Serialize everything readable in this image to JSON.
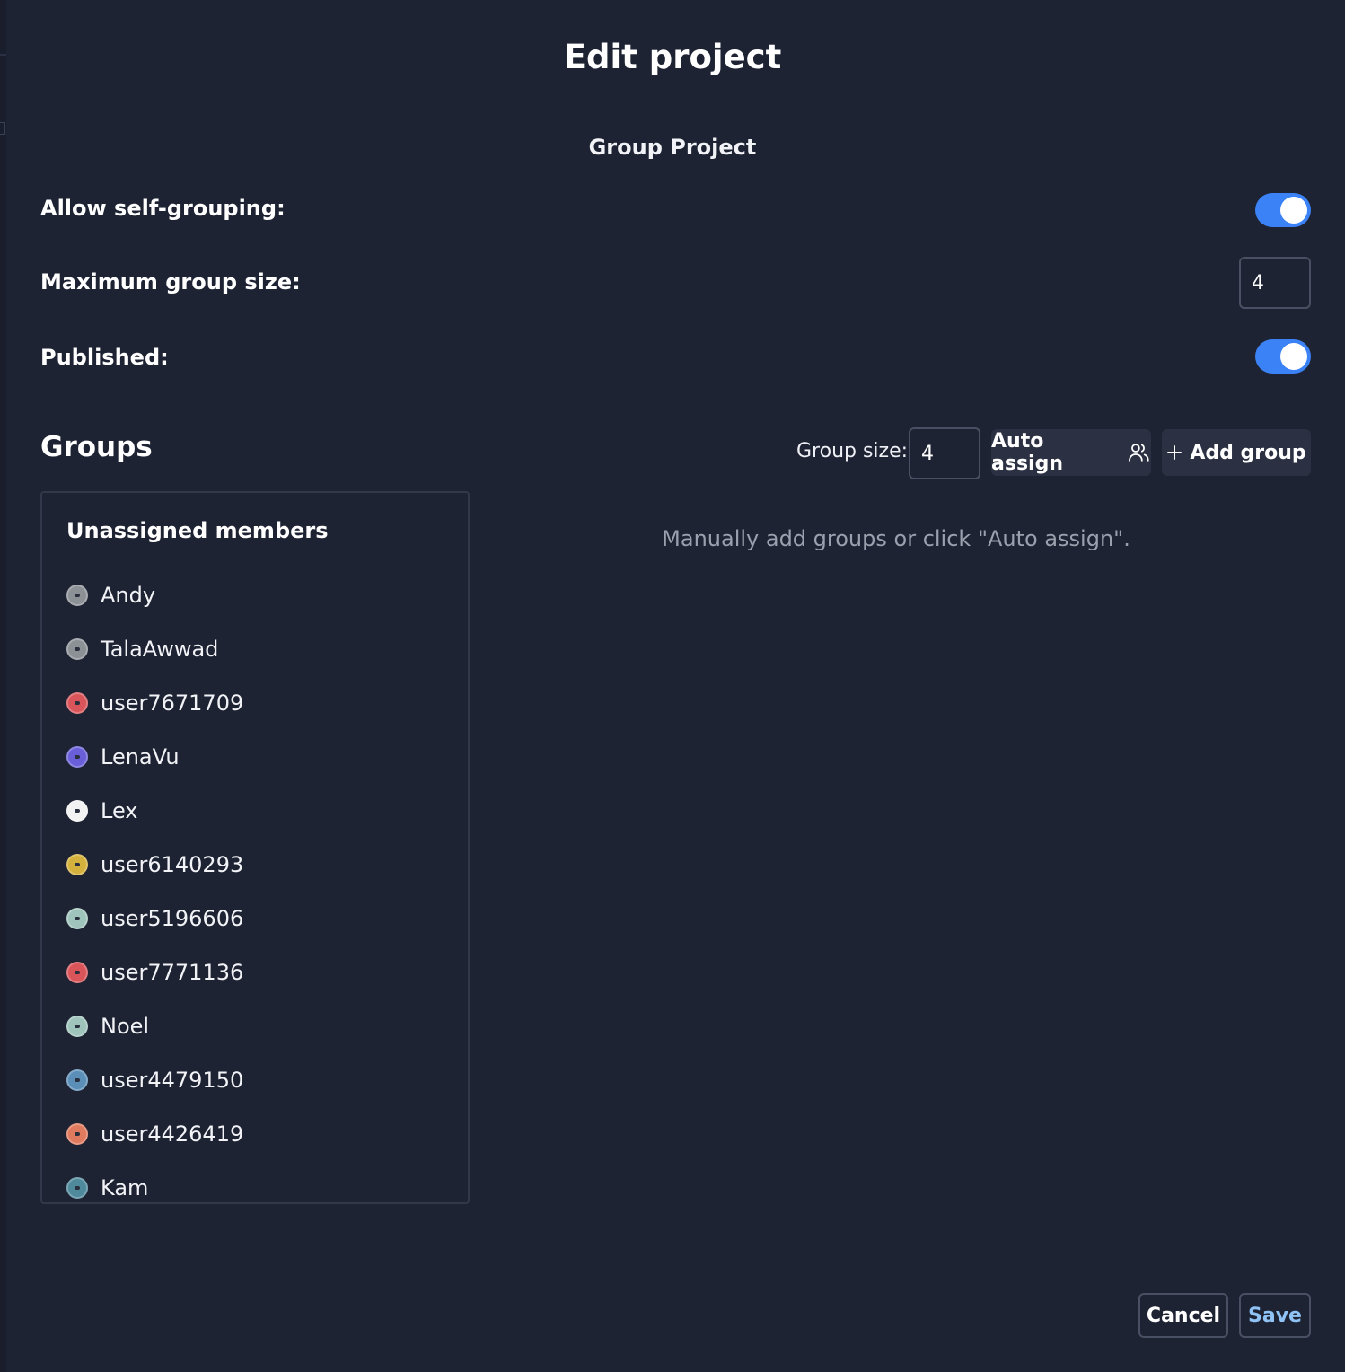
{
  "dialog": {
    "title": "Edit project",
    "project_name": "Group Project"
  },
  "settings": {
    "allow_self_grouping": {
      "label": "Allow self-grouping:",
      "enabled": true
    },
    "max_group_size": {
      "label": "Maximum group size:",
      "value": "4"
    },
    "published": {
      "label": "Published:",
      "enabled": true
    }
  },
  "groups": {
    "heading": "Groups",
    "group_size_label": "Group size:",
    "group_size_value": "4",
    "auto_assign_label": "Auto assign",
    "add_group_label": "Add group",
    "empty_hint": "Manually add groups or click \"Auto assign\".",
    "unassigned": {
      "heading": "Unassigned members",
      "members": [
        {
          "name": "Andy",
          "avatar_color": "#8c9196"
        },
        {
          "name": "TalaAwwad",
          "avatar_color": "#8c9196"
        },
        {
          "name": "user7671709",
          "avatar_color": "#d9555a"
        },
        {
          "name": "LenaVu",
          "avatar_color": "#6a5fd8"
        },
        {
          "name": "Lex",
          "avatar_color": "#f2f2f2"
        },
        {
          "name": "user6140293",
          "avatar_color": "#d4b13c"
        },
        {
          "name": "user5196606",
          "avatar_color": "#9fc4bb"
        },
        {
          "name": "user7771136",
          "avatar_color": "#d9555a"
        },
        {
          "name": "Noel",
          "avatar_color": "#9fc4bb"
        },
        {
          "name": "user4479150",
          "avatar_color": "#5b8fb8"
        },
        {
          "name": "user4426419",
          "avatar_color": "#e07a5f"
        },
        {
          "name": "Kam",
          "avatar_color": "#4f8a9c"
        }
      ]
    }
  },
  "footer": {
    "cancel_label": "Cancel",
    "save_label": "Save"
  },
  "colors": {
    "background": "#1e2333",
    "accent": "#3b82f6",
    "save_text": "#8fc3f5",
    "muted_text": "#9aa0ad"
  }
}
